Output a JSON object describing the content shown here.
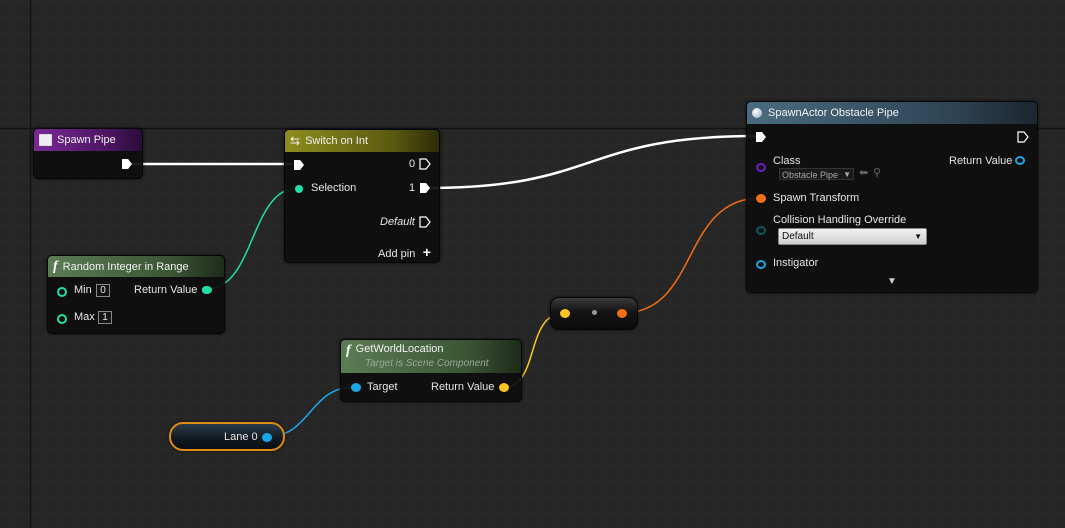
{
  "colors": {
    "background": "#262626",
    "exec": "#ffffff",
    "integer": "#1fe0a8",
    "vector": "#fdc521",
    "transform": "#f46f12",
    "object": "#1aa7e8",
    "class": "#6d1fc9",
    "header_event": "#6a1f82",
    "header_switch": "#7c7c16",
    "header_function": "#4a6d44",
    "header_spawn": "#3c5a6e"
  },
  "nodes": {
    "spawn_pipe": {
      "title": "Spawn Pipe",
      "icon": "event-icon"
    },
    "switch_on_int": {
      "title": "Switch on Int",
      "icon": "switch-icon",
      "selection_label": "Selection",
      "out_0": "0",
      "out_1": "1",
      "default_label": "Default",
      "add_pin_label": "Add pin"
    },
    "random_int": {
      "title": "Random Integer in Range",
      "icon": "function-icon",
      "min_label": "Min",
      "min_value": "0",
      "max_label": "Max",
      "max_value": "1",
      "return_label": "Return Value"
    },
    "get_world_location": {
      "title": "GetWorldLocation",
      "subtitle": "Target is Scene Component",
      "icon": "function-icon",
      "target_label": "Target",
      "return_label": "Return Value"
    },
    "lane0": {
      "label": "Lane 0"
    },
    "spawn_actor": {
      "title": "SpawnActor Obstacle Pipe",
      "icon": "spawn-icon",
      "class_label": "Class",
      "class_value": "Obstacle Pipe",
      "return_label": "Return Value",
      "spawn_transform_label": "Spawn Transform",
      "collision_label": "Collision Handling Override",
      "collision_value": "Default",
      "instigator_label": "Instigator"
    }
  }
}
